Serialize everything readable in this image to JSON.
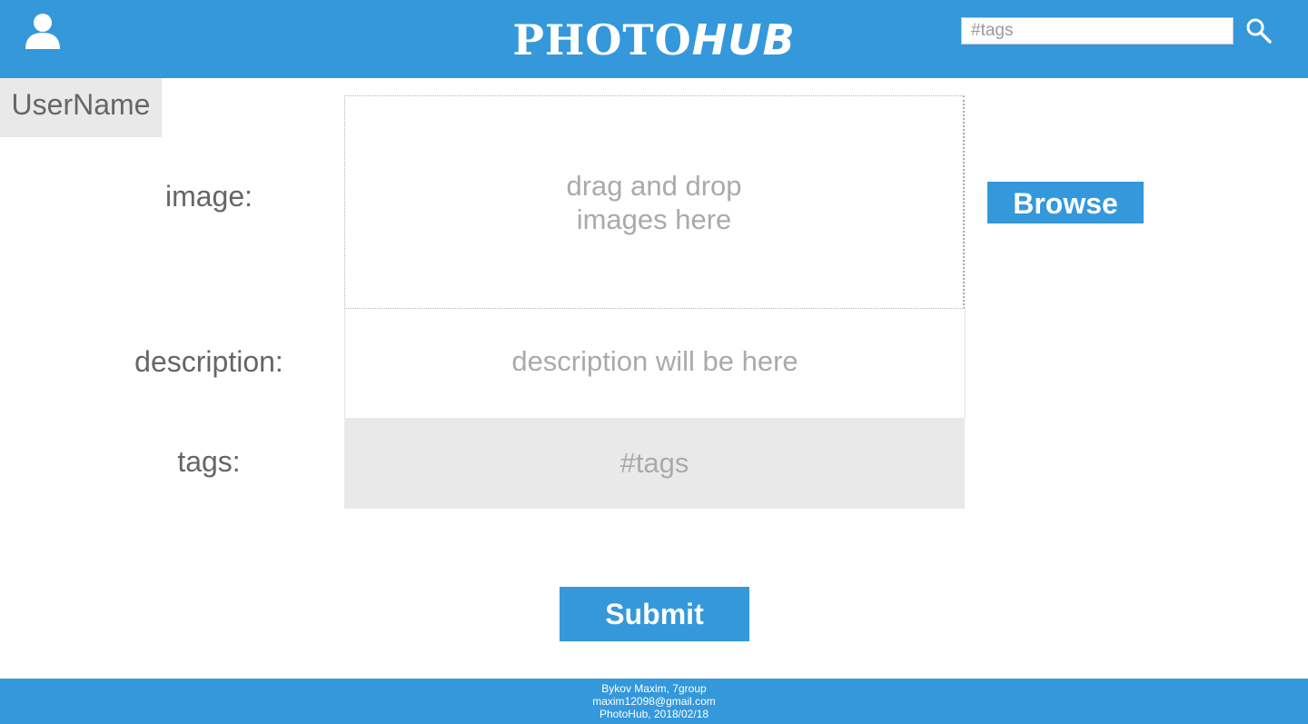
{
  "header": {
    "logo_main": "PHOTO",
    "logo_accent": "HUB",
    "search_placeholder": "#tags",
    "user_icon": "user-icon",
    "search_icon": "search-icon"
  },
  "sidebar": {
    "username": "UserName"
  },
  "form": {
    "image_label": "image:",
    "dropzone_line1": "drag and drop",
    "dropzone_line2": "images here",
    "browse_label": "Browse",
    "description_label": "description:",
    "description_placeholder": "description will be here",
    "tags_label": "tags:",
    "tags_placeholder": "#tags",
    "submit_label": "Submit"
  },
  "footer": {
    "line1": "Bykov Maxim, 7group",
    "line2": "maxim12098@gmail.com",
    "line3": "PhotoHub, 2018/02/18"
  },
  "colors": {
    "brand": "#3498db",
    "panel_gray": "#e9e9e9",
    "label_text": "#666666",
    "placeholder_text": "#aaaaaa"
  }
}
